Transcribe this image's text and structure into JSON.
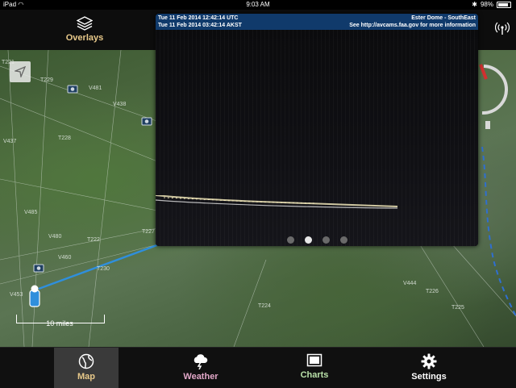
{
  "status_bar": {
    "carrier": "iPad",
    "time": "9:03 AM",
    "battery": "98%"
  },
  "top_bar": {
    "overlays_label": "Overlays",
    "overlays_icon": "layers-icon",
    "radio_icon": "broadcast-icon"
  },
  "map": {
    "scale_label": "10 miles",
    "route_labels": [
      "T221",
      "T229",
      "V481",
      "V438",
      "V437",
      "T228",
      "V480",
      "V444",
      "T226",
      "T222",
      "T227",
      "V460",
      "T230",
      "V485",
      "T225",
      "T224",
      "V453"
    ],
    "route_color": "#2f8fdc"
  },
  "webcam": {
    "utc_time": "Tue 11 Feb 2014 12:42:14 UTC",
    "local_time": "Tue 11 Feb 2014 03:42:14 AKST",
    "location": "Ester Dome - SouthEast",
    "source": "See http://avcams.faa.gov for more information",
    "page_count": 4,
    "active_page": 2
  },
  "tabs": [
    {
      "label": "Map",
      "icon": "globe-icon",
      "selected": true
    },
    {
      "label": "Weather",
      "icon": "storm-cloud-icon",
      "selected": false
    },
    {
      "label": "Charts",
      "icon": "chart-window-icon",
      "selected": false
    },
    {
      "label": "Settings",
      "icon": "gear-icon",
      "selected": false
    }
  ]
}
